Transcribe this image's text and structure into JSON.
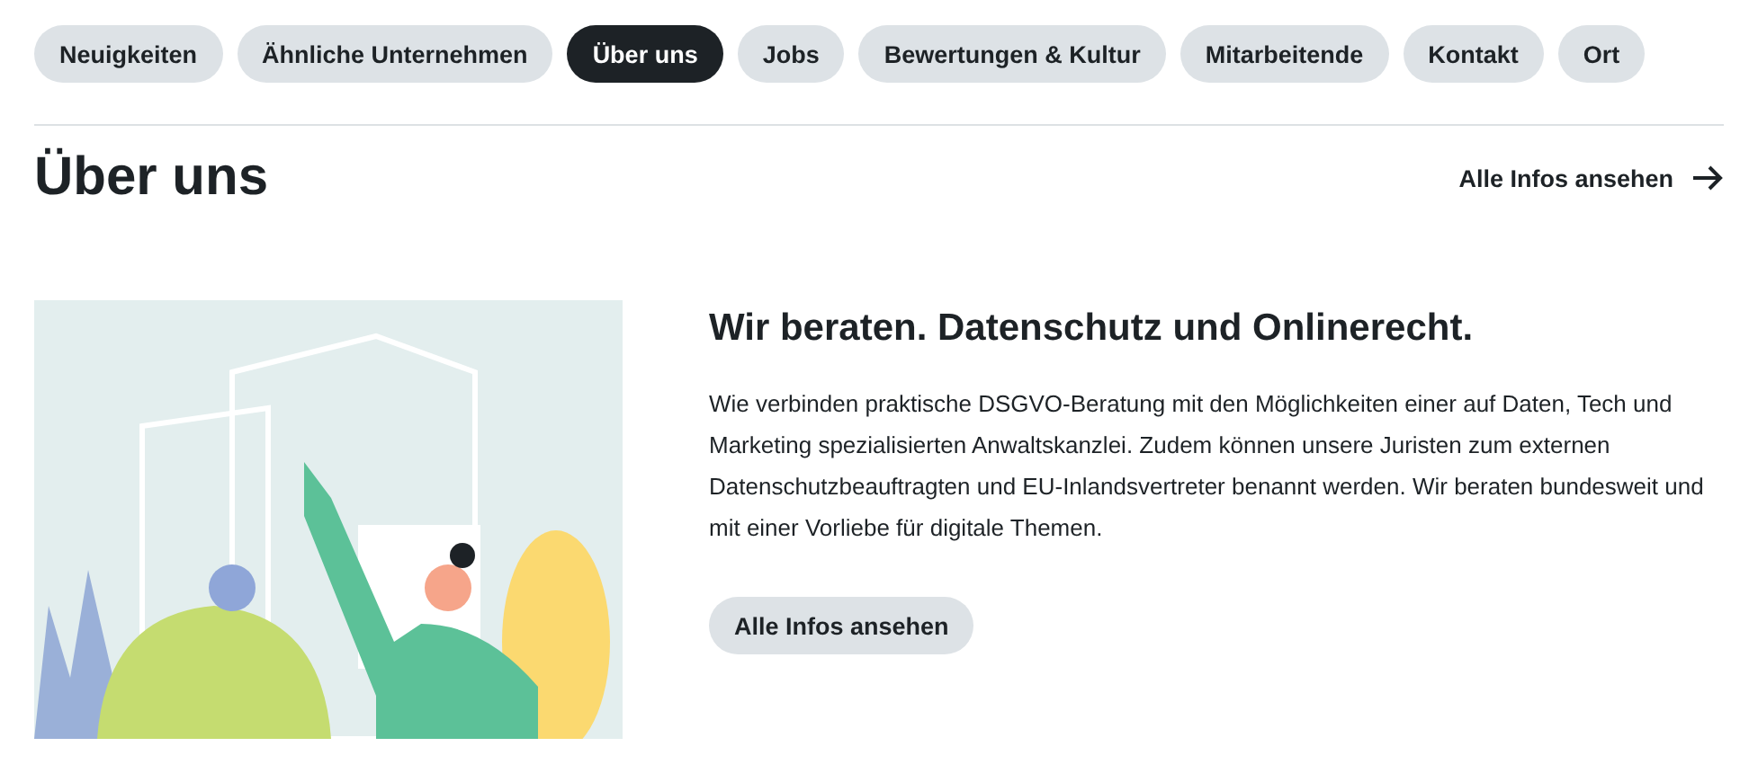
{
  "tabs": [
    {
      "label": "Neuigkeiten",
      "selected": false
    },
    {
      "label": "Ähnliche Unternehmen",
      "selected": false
    },
    {
      "label": "Über uns",
      "selected": true
    },
    {
      "label": "Jobs",
      "selected": false
    },
    {
      "label": "Bewertungen & Kultur",
      "selected": false
    },
    {
      "label": "Mitarbeitende",
      "selected": false
    },
    {
      "label": "Kontakt",
      "selected": false
    },
    {
      "label": "Ort",
      "selected": false
    }
  ],
  "section": {
    "title": "Über uns",
    "link": "Alle Infos ansehen"
  },
  "content": {
    "heading": "Wir beraten. Datenschutz und Onlinerecht.",
    "text": "Wie verbinden praktische DSGVO-Beratung mit den Möglichkeiten einer auf Daten, Tech und Marketing spezialisierten Anwaltskanzlei. Zudem können unsere Juristen zum externen Datenschutzbeauftragten und EU-Inlandsvertreter benannt werden. Wir beraten bundesweit und mit einer Vorliebe für digitale Themen.",
    "button": "Alle Infos ansehen"
  }
}
